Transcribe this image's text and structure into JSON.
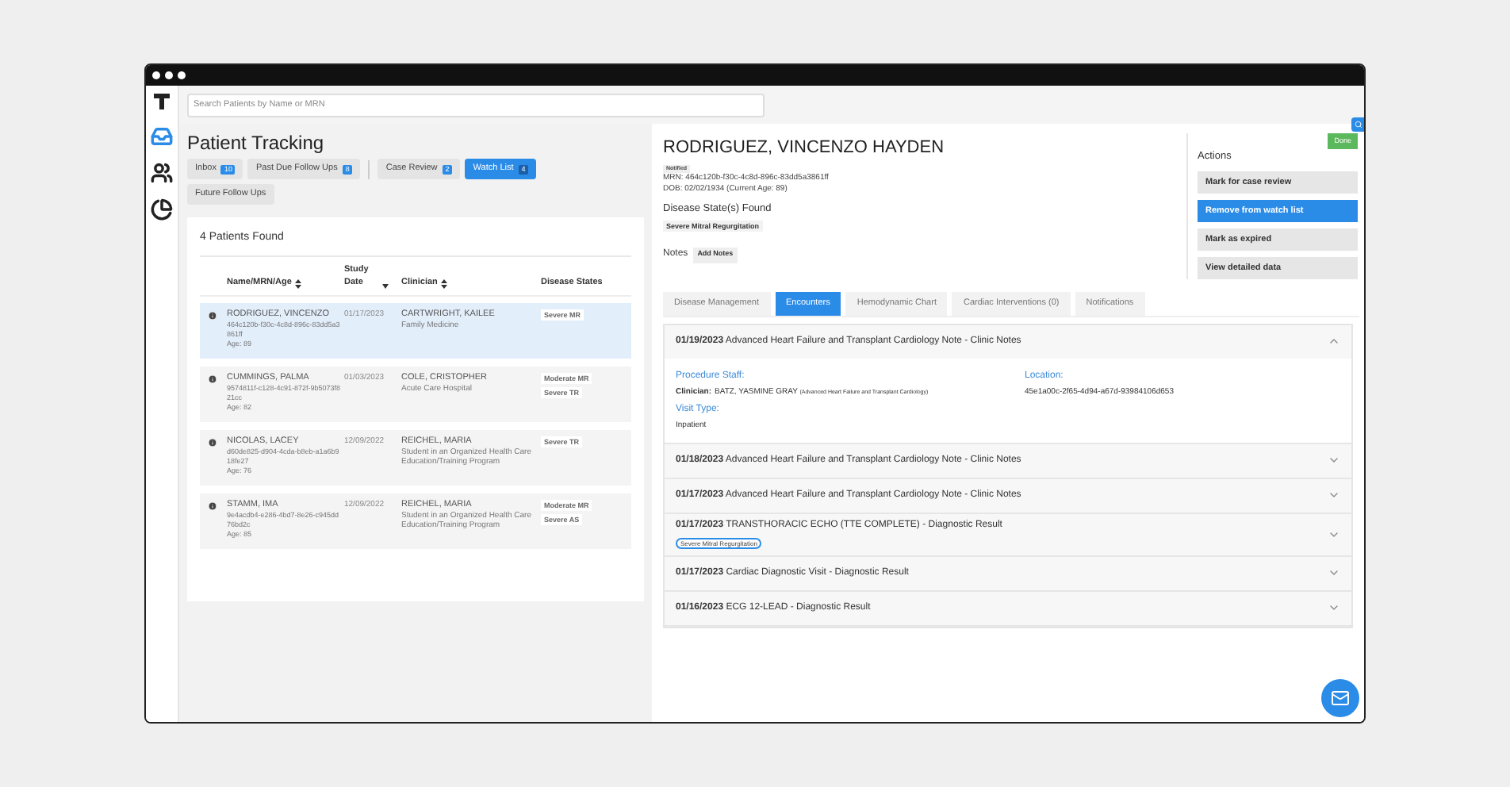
{
  "search": {
    "placeholder": "Search Patients by Name or MRN"
  },
  "nav": [
    {
      "kind": "logo",
      "selected": false
    },
    {
      "kind": "inbox",
      "selected": true
    },
    {
      "kind": "people",
      "selected": false
    },
    {
      "kind": "chart",
      "selected": false
    }
  ],
  "page_title": "Patient Tracking",
  "filters": [
    {
      "label": "Inbox",
      "count": "10",
      "selected": false
    },
    {
      "label": "Past Due Follow Ups",
      "count": "8",
      "selected": false
    },
    {
      "label": "Case Review",
      "count": "2",
      "selected": false
    },
    {
      "label": "Watch List",
      "count": "4",
      "selected": true
    },
    {
      "label": "Future Follow Ups",
      "selected": false
    }
  ],
  "results": {
    "title": "4 Patients Found",
    "columns": [
      {
        "label": "Name/MRN/Age",
        "kind": "sortable"
      },
      {
        "label": "Study Date",
        "kind": "sorted"
      },
      {
        "label": "Clinician",
        "kind": "sortable"
      },
      {
        "label": "Disease States",
        "kind": "plain"
      }
    ],
    "rows": [
      {
        "selected": true,
        "name": "RODRIGUEZ, VINCENZO",
        "mrn": "464c120b-f30c-4c8d-896c-83dd5a3861ff",
        "age": "Age: 89",
        "date": "01/17/2023",
        "clinician": "CARTWRIGHT, KAILEE",
        "specialty": "Family Medicine",
        "states": [
          "Severe MR"
        ]
      },
      {
        "selected": false,
        "name": "CUMMINGS, PALMA",
        "mrn": "9574811f-c128-4c91-872f-9b5073f821cc",
        "age": "Age: 82",
        "date": "01/03/2023",
        "clinician": "COLE, CRISTOPHER",
        "specialty": "Acute Care Hospital",
        "states": [
          "Moderate MR",
          "Severe TR"
        ]
      },
      {
        "selected": false,
        "name": "NICOLAS, LACEY",
        "mrn": "d60de825-d904-4cda-b8eb-a1a6b918fe27",
        "age": "Age: 76",
        "date": "12/09/2022",
        "clinician": "REICHEL, MARIA",
        "specialty": "Student in an Organized Health Care Education/Training Program",
        "states": [
          "Severe TR"
        ]
      },
      {
        "selected": false,
        "name": "STAMM, IMA",
        "mrn": "9e4acdb4-e286-4bd7-8e26-c945dd76bd2c",
        "age": "Age: 85",
        "date": "12/09/2022",
        "clinician": "REICHEL, MARIA",
        "specialty": "Student in an Organized Health Care Education/Training Program",
        "states": [
          "Moderate MR",
          "Severe AS"
        ]
      }
    ]
  },
  "patient": {
    "name": "RODRIGUEZ, VINCENZO HAYDEN",
    "badge": "Notified",
    "mrn": "MRN: 464c120b-f30c-4c8d-896c-83dd5a3861ff",
    "dob": "DOB: 02/02/1934 (Current Age: 89)",
    "disease_heading": "Disease State(s) Found",
    "disease": "Severe Mitral Regurgitation",
    "notes_label": "Notes",
    "add_notes": "Add Notes"
  },
  "actions": {
    "done": "Done",
    "title": "Actions",
    "buttons": [
      {
        "label": "Mark for case review",
        "selected": false
      },
      {
        "label": "Remove from watch list",
        "selected": true
      },
      {
        "label": "Mark as expired",
        "selected": false
      },
      {
        "label": "View detailed data",
        "selected": false
      }
    ]
  },
  "tabs": [
    {
      "label": "Disease Management",
      "selected": false
    },
    {
      "label": "Encounters",
      "selected": true
    },
    {
      "label": "Hemodynamic Chart",
      "selected": false
    },
    {
      "label": "Cardiac Interventions (0)",
      "selected": false
    },
    {
      "label": "Notifications",
      "selected": false
    }
  ],
  "encounters": [
    {
      "date": "01/19/2023",
      "title": "Advanced Heart Failure and Transplant Cardiology Note - Clinic Notes",
      "expanded": true,
      "details": {
        "staff_label": "Procedure Staff:",
        "clinician_label": "Clinician:",
        "clinician": "BATZ, YASMINE GRAY",
        "clinician_note": "(Advanced Heart Failure and Transplant Cardiology)",
        "location_label": "Location:",
        "location": "45e1a00c-2f65-4d94-a67d-93984106d653",
        "visit_label": "Visit Type:",
        "visit": "Inpatient"
      }
    },
    {
      "date": "01/18/2023",
      "title": "Advanced Heart Failure and Transplant Cardiology Note - Clinic Notes",
      "expanded": false
    },
    {
      "date": "01/17/2023",
      "title": "Advanced Heart Failure and Transplant Cardiology Note - Clinic Notes",
      "expanded": false
    },
    {
      "date": "01/17/2023",
      "title": "TRANSTHORACIC ECHO (TTE COMPLETE) - Diagnostic Result",
      "expanded": false,
      "tag": "Severe Mitral Regurgitation"
    },
    {
      "date": "01/17/2023",
      "title": "Cardiac Diagnostic Visit - Diagnostic Result",
      "expanded": false
    },
    {
      "date": "01/16/2023",
      "title": "ECG 12-LEAD - Diagnostic Result",
      "expanded": false
    }
  ]
}
